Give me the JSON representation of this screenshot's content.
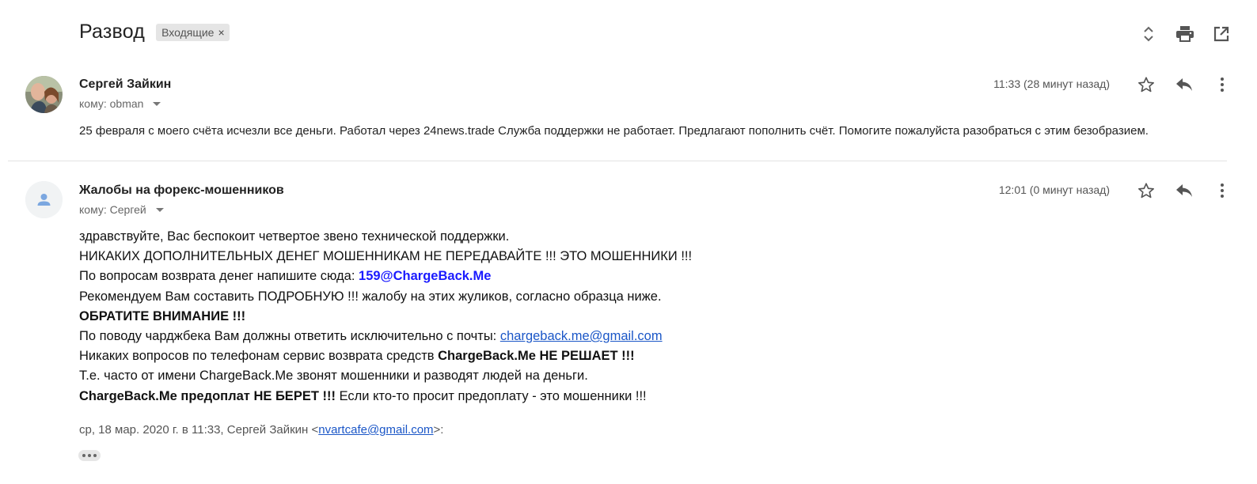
{
  "thread": {
    "subject": "Развод",
    "label": "Входящие",
    "label_remove": "×"
  },
  "top_actions": [
    "expand-collapse-icon",
    "print-icon",
    "open-new-window-icon"
  ],
  "messages": [
    {
      "sender": "Сергей Зайкин",
      "to": "кому: obman",
      "time": "11:33 (28 минут назад)",
      "snippet": "25 февраля с моего счёта исчезли все деньги. Работал через 24news.trade Служба поддержки не работает. Предлагают пополнить счёт. Помогите пожалуйста разобраться с этим безобразием."
    },
    {
      "sender": "Жалобы на форекс-мошенников",
      "to": "кому: Сергей",
      "time": "12:01 (0 минут назад)",
      "body": {
        "l1": "здравствуйте, Вас беспокоит четвертое звено технической поддержки.",
        "l2": "НИКАКИХ ДОПОЛНИТЕЛЬНЫХ ДЕНЕГ МОШЕННИКАМ НЕ ПЕРЕДАВАЙТЕ !!! ЭТО МОШЕННИКИ !!!",
        "l3_text": "По вопросам возврата денег напишите сюда: ",
        "l3_email": "159@ChargeBack.Me",
        "l4": "Рекомендуем Вам составить ПОДРОБНУЮ !!! жалобу на этих жуликов, согласно образца ниже.",
        "l5": "ОБРАТИТЕ ВНИМАНИЕ !!!",
        "l6_text": "По поводу чарджбека Вам должны ответить исключительно с почты: ",
        "l6_link": "chargeback.me@gmail.com",
        "l7_text": "Никаких вопросов по телефонам сервис возврата средств ",
        "l7_bold": "ChargeBack.Me НЕ РЕШАЕТ !!!",
        "l8": "Т.е. часто от имени ChargeBack.Me звонят мошенники и разводят людей на деньги.",
        "l9_bold": "ChargeBack.Me предоплат НЕ БЕРЕТ !!!",
        "l9_text": " Если кто-то просит предоплату - это мошенники !!!"
      },
      "quote": {
        "prefix": "ср, 18 мар. 2020 г. в 11:33, Сергей Зайкин <",
        "email": "nvartcafe@gmail.com",
        "suffix": ">:"
      }
    }
  ],
  "colors": {
    "link": "#1a56c7",
    "email_highlight": "#1a1aff",
    "label_bg": "#e5e5e5"
  }
}
